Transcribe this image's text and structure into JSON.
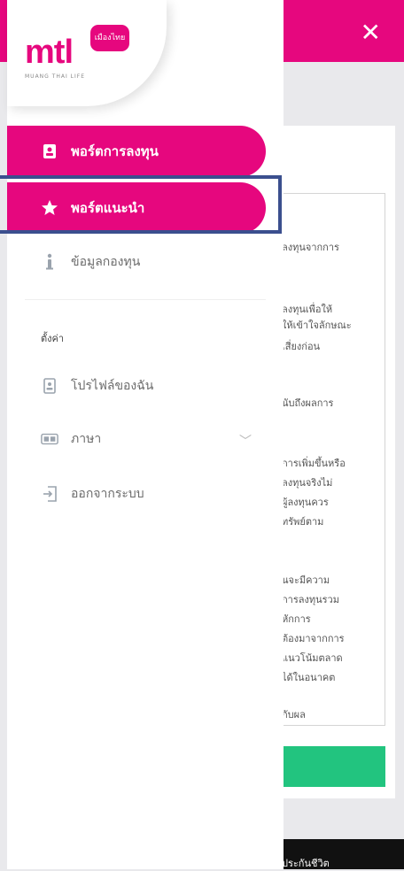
{
  "header": {
    "close_icon": "close-icon",
    "accent": "#e6077e"
  },
  "brand": {
    "logo_text": "mtl",
    "badge_text": "เมืองไทย",
    "tagline": "MUANG THAI LIFE"
  },
  "menu": {
    "investment_port": {
      "label": "พอร์ตการลงทุน",
      "icon": "portfolio-icon"
    },
    "recommended_port": {
      "label": "พอร์ตแนะนำ",
      "icon": "star-icon"
    },
    "fund_info": {
      "label": "ข้อมูลกองทุน",
      "icon": "info-icon"
    }
  },
  "settings": {
    "section_label": "ตั้งค่า",
    "profile": {
      "label": "โปรไฟล์ของฉัน",
      "icon": "profile-icon"
    },
    "language": {
      "label": "ภาษา",
      "icon": "language-icon"
    },
    "logout": {
      "label": "ออกจากระบบ",
      "icon": "logout-icon"
    }
  },
  "background_page": {
    "lines": [
      "ลงทุนจากการ",
      "ลงทุนเพื่อให้",
      "ให้เข้าใจลักษณะ",
      "เสี่ยงก่อน",
      "นับถึงผลการ",
      "การเพิ่มขึ้นหรือ",
      "ลงทุนจริงไม่",
      "ผู้ลงทุนควร",
      "ทรัพย์ตาม",
      "นจะมีความ",
      "การลงทุนรวม",
      "หักการ",
      "ต้องมาจากการ",
      "แนวโน้มตลาด",
      "ได้ในอนาคต",
      "กับผล"
    ],
    "footer_text": "ประกันชีวิต"
  }
}
